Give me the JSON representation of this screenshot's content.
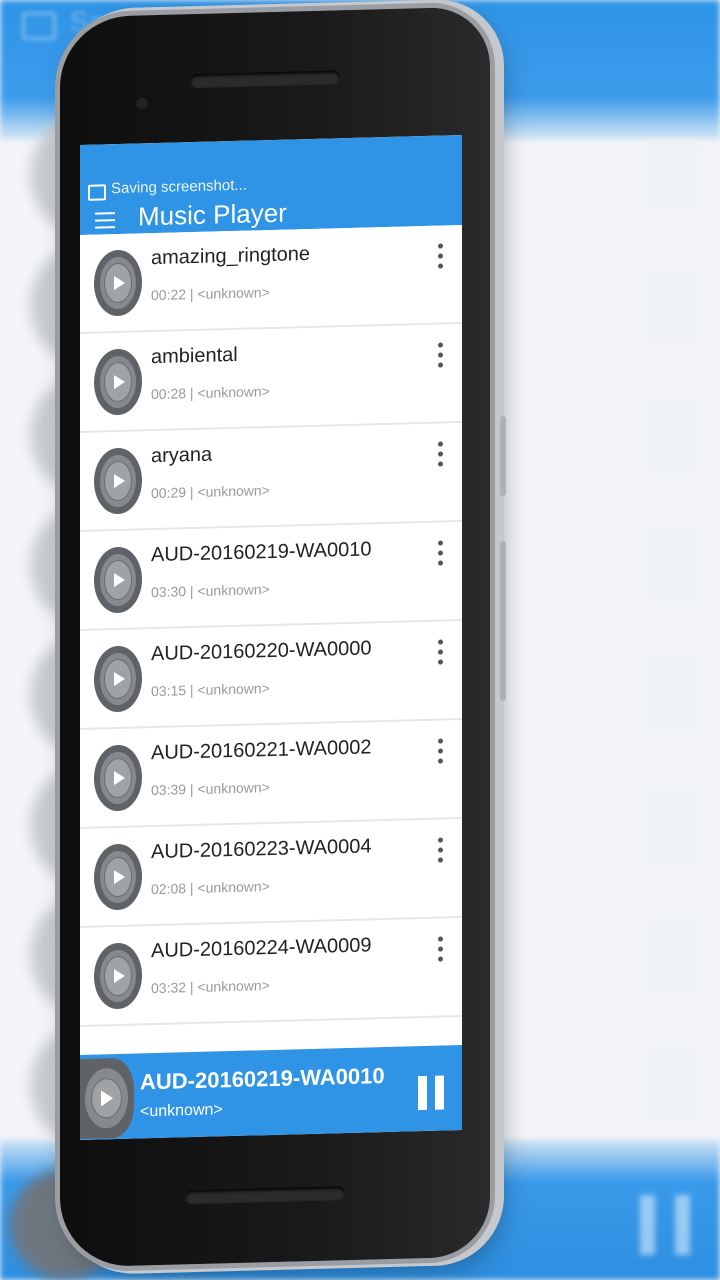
{
  "status": {
    "text": "Saving screenshot..."
  },
  "app": {
    "title": "Music Player"
  },
  "tracks": [
    {
      "title": "amazing_ringtone",
      "meta": "00:22 | <unknown>"
    },
    {
      "title": "ambiental",
      "meta": "00:28 | <unknown>"
    },
    {
      "title": "aryana",
      "meta": "00:29 | <unknown>"
    },
    {
      "title": "AUD-20160219-WA0010",
      "meta": "03:30 | <unknown>"
    },
    {
      "title": "AUD-20160220-WA0000",
      "meta": "03:15 | <unknown>"
    },
    {
      "title": "AUD-20160221-WA0002",
      "meta": "03:39 | <unknown>"
    },
    {
      "title": "AUD-20160223-WA0004",
      "meta": "02:08 | <unknown>"
    },
    {
      "title": "AUD-20160224-WA0009",
      "meta": "03:32 | <unknown>"
    }
  ],
  "now_playing": {
    "title": "AUD-20160219-WA0010",
    "artist": "<unknown>"
  },
  "colors": {
    "primary": "#2f94e6",
    "disc": "#5f6266"
  }
}
